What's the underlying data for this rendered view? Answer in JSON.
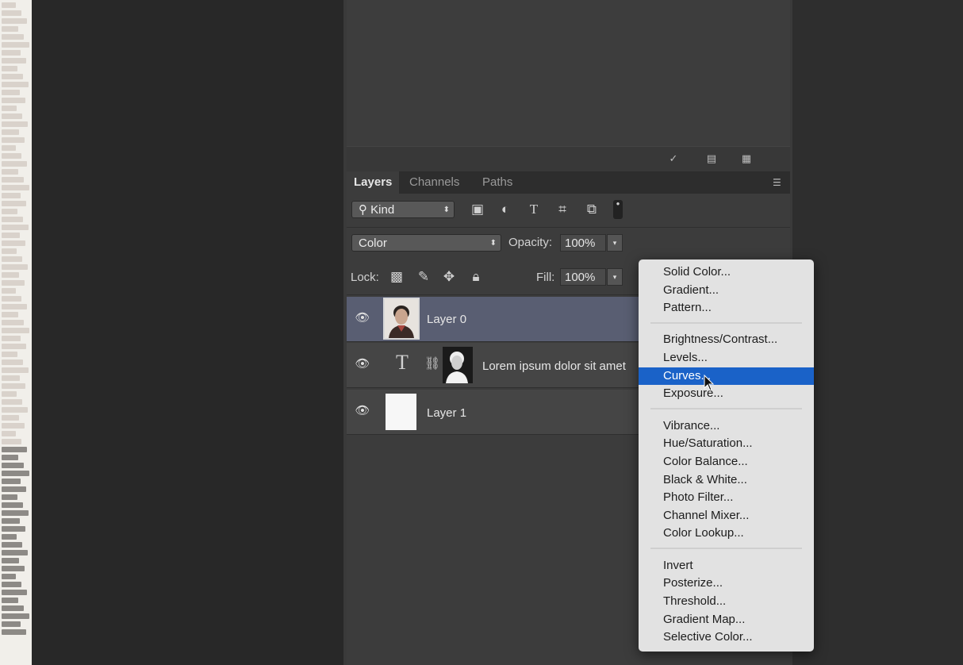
{
  "upper_footer": {
    "icons": [
      "checkmark-icon",
      "new-snapshot-icon",
      "delete-icon"
    ]
  },
  "layers_panel": {
    "tabs": [
      {
        "label": "Layers",
        "active": true
      },
      {
        "label": "Channels",
        "active": false
      },
      {
        "label": "Paths",
        "active": false
      }
    ],
    "filter": {
      "kind_label": "Kind",
      "icons": [
        "image-filter-icon",
        "adjustment-filter-icon",
        "type-filter-icon",
        "shape-filter-icon",
        "smart-object-filter-icon",
        "filter-toggle-icon"
      ]
    },
    "blend_mode": "Color",
    "opacity_label": "Opacity:",
    "opacity_value": "100%",
    "lock_label": "Lock:",
    "lock_icons": [
      "lock-transparent-icon",
      "lock-pixels-icon",
      "lock-position-icon",
      "lock-all-icon"
    ],
    "fill_label": "Fill:",
    "fill_value": "100%",
    "layers": [
      {
        "name": "Layer 0",
        "selected": true,
        "type": "image"
      },
      {
        "name": "Lorem ipsum dolor sit amet",
        "selected": false,
        "type": "text"
      },
      {
        "name": "Layer 1",
        "selected": false,
        "type": "fill"
      }
    ]
  },
  "adjustment_menu": {
    "groups": [
      [
        "Solid Color...",
        "Gradient...",
        "Pattern..."
      ],
      [
        "Brightness/Contrast...",
        "Levels...",
        "Curves...",
        "Exposure..."
      ],
      [
        "Vibrance...",
        "Hue/Saturation...",
        "Color Balance...",
        "Black & White...",
        "Photo Filter...",
        "Channel Mixer...",
        "Color Lookup..."
      ],
      [
        "Invert",
        "Posterize...",
        "Threshold...",
        "Gradient Map...",
        "Selective Color..."
      ]
    ],
    "highlighted": "Curves...",
    "highlight_color": "#1a62c8"
  }
}
